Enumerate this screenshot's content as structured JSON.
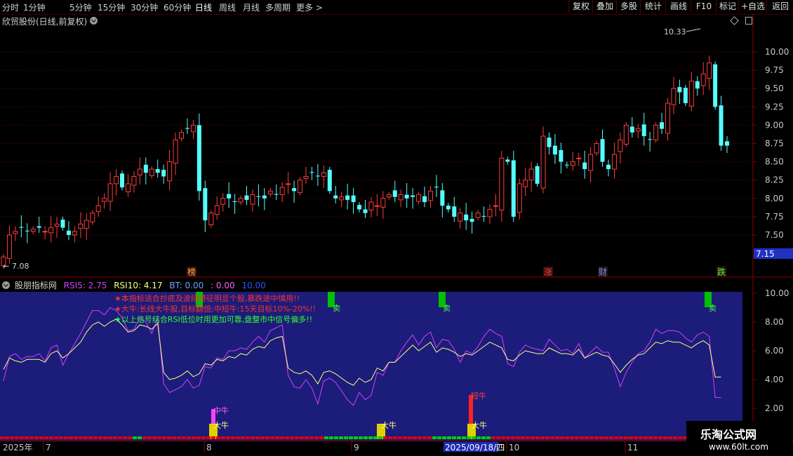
{
  "toolbar": {
    "periods": [
      "分时",
      "1分钟",
      "5分钟",
      "15分钟",
      "30分钟",
      "60分钟",
      "日线",
      "周线",
      "月线",
      "多周期",
      "更多 >"
    ],
    "active_period": "日线",
    "buttons": [
      "复权",
      "叠加",
      "多股",
      "统计",
      "画线",
      "F10",
      "标记",
      "+自选",
      "返回"
    ]
  },
  "main_chart": {
    "title": "欣贸股份(日线,前复权)",
    "high_label": "10.33",
    "low_label": "7.08",
    "last_price": "7.15",
    "y_axis": [
      "10.00",
      "9.75",
      "9.50",
      "9.25",
      "9.00",
      "8.75",
      "8.50",
      "8.25",
      "8.00",
      "7.75",
      "7.50"
    ],
    "markers": [
      "榜",
      "涨",
      "财",
      "跌"
    ],
    "colors": {
      "up": "#ff3c3c",
      "down": "#54ffff",
      "grid": "#6a0000",
      "axis_text": "#c8c8c8"
    }
  },
  "indicator": {
    "name": "股朋指标网",
    "rsi5_label": "RSI5: 2.75",
    "rsi10_label": "RSI10: 4.17",
    "bt_label": "BT: 0.00",
    "v1": ": 0.00",
    "v2": "10.00",
    "y_axis": [
      "10.00",
      "8.00",
      "6.00",
      "4.00",
      "2.00"
    ],
    "notes": [
      "★本指标适合抄底及波段特征明显个股,暴跌途中慎用!!",
      "★大牛:长线大牛股,目标翻倍;中短牛:15天目标10%-20%!!",
      "★以上信号结合RSI低位时用更加可靠,盘整市中信号偏多!!"
    ],
    "sell_label": "卖",
    "signals": [
      "中牛",
      "大牛",
      "大牛",
      "短牛",
      "大牛"
    ],
    "colors": {
      "bg": "#1c1c7a",
      "rsi5": "#d040ff",
      "rsi10": "#ffff80"
    }
  },
  "date_axis": {
    "year": "2025年",
    "months": [
      "7",
      "8",
      "9",
      "10",
      "11"
    ],
    "cursor_date": "2025/09/18/四"
  },
  "watermark": {
    "name": "乐淘公式网",
    "url": "www.60lt.com"
  },
  "chart_data": [
    {
      "type": "candlestick",
      "title": "欣贸股份(日线,前复权)",
      "ylim": [
        7.08,
        10.33
      ],
      "series": [
        {
          "name": "close",
          "values": [
            7.2,
            7.5,
            7.55,
            7.6,
            7.55,
            7.58,
            7.6,
            7.55,
            7.6,
            7.65,
            7.6,
            7.5,
            7.55,
            7.65,
            7.7,
            7.8,
            7.9,
            8.0,
            8.2,
            8.3,
            8.15,
            8.2,
            8.3,
            8.4,
            8.35,
            8.4,
            8.35,
            8.3,
            8.5,
            8.8,
            8.9,
            8.95,
            9.0,
            8.1,
            7.7,
            7.8,
            7.9,
            8.0,
            8.0,
            7.95,
            8.0,
            7.98,
            8.05,
            8.02,
            8.0,
            8.1,
            8.05,
            8.15,
            8.2,
            8.1,
            8.25,
            8.3,
            8.35,
            8.3,
            8.35,
            8.1,
            8.0,
            8.02,
            7.98,
            7.95,
            7.85,
            7.8,
            7.95,
            7.9,
            8.0,
            8.05,
            8.02,
            8.05,
            8.0,
            8.02,
            8.05,
            7.95,
            8.1,
            8.15,
            7.9,
            7.85,
            7.75,
            7.8,
            7.7,
            7.68,
            7.8,
            7.75,
            7.85,
            7.9,
            8.55,
            8.5,
            7.75,
            8.2,
            8.25,
            8.4,
            8.2,
            8.85,
            8.7,
            8.6,
            8.5,
            8.45,
            8.5,
            8.55,
            8.4,
            8.6,
            8.75,
            8.5,
            8.4,
            8.6,
            8.8,
            9.0,
            8.9,
            8.95,
            8.85,
            8.8,
            9.0,
            8.95,
            9.3,
            9.5,
            9.45,
            9.3,
            9.6,
            9.5,
            9.7,
            9.85,
            9.25,
            8.72,
            8.72
          ]
        }
      ]
    },
    {
      "type": "line",
      "title": "股朋指标网",
      "ylim": [
        1.0,
        10.0
      ],
      "series": [
        {
          "name": "RSI5",
          "values": [
            3.9,
            5.6,
            5.8,
            5.4,
            5.6,
            5.6,
            5.8,
            5.3,
            6.2,
            6.4,
            5.0,
            5.8,
            6.5,
            7.2,
            8.0,
            8.8,
            8.8,
            8.5,
            9.0,
            8.8,
            8.3,
            7.4,
            7.5,
            8.3,
            8.0,
            7.2,
            8.3,
            3.7,
            3.1,
            3.3,
            3.5,
            4.0,
            3.4,
            3.6,
            4.9,
            4.8,
            5.5,
            5.4,
            6.0,
            6.0,
            6.2,
            6.1,
            6.6,
            7.0,
            6.6,
            7.4,
            7.6,
            7.8,
            4.3,
            3.5,
            3.4,
            4.0,
            3.4,
            2.3,
            3.9,
            4.1,
            3.8,
            3.2,
            2.6,
            2.2,
            3.1,
            2.6,
            2.9,
            4.5,
            4.3,
            5.2,
            5.2,
            6.0,
            6.6,
            7.1,
            6.4,
            7.0,
            7.3,
            6.2,
            6.8,
            6.7,
            6.1,
            5.2,
            6.0,
            5.8,
            6.3,
            7.0,
            7.5,
            7.2,
            7.0,
            5.1,
            4.9,
            5.9,
            6.4,
            6.2,
            6.1,
            6.0,
            6.8,
            6.4,
            6.0,
            6.1,
            5.8,
            6.5,
            5.5,
            5.9,
            6.3,
            5.9,
            5.9,
            4.8,
            3.5,
            4.5,
            5.2,
            5.8,
            6.0,
            6.6,
            7.5,
            7.2,
            7.4,
            7.4,
            7.3,
            6.9,
            6.6,
            7.1,
            7.3,
            7.0,
            2.75,
            2.75
          ]
        },
        {
          "name": "RSI10",
          "values": [
            4.7,
            5.5,
            5.3,
            5.2,
            5.4,
            5.4,
            5.4,
            5.2,
            5.8,
            6.0,
            5.5,
            5.8,
            6.2,
            6.6,
            7.3,
            7.8,
            8.0,
            7.7,
            8.0,
            8.2,
            7.8,
            7.3,
            7.4,
            7.8,
            7.7,
            7.5,
            7.9,
            4.5,
            4.0,
            4.1,
            4.3,
            4.6,
            4.2,
            4.4,
            5.1,
            5.0,
            5.4,
            5.3,
            5.6,
            5.5,
            5.8,
            5.7,
            6.1,
            6.3,
            6.2,
            6.7,
            6.9,
            7.0,
            4.8,
            4.5,
            4.4,
            4.6,
            4.3,
            3.7,
            4.5,
            4.6,
            4.4,
            4.1,
            3.8,
            3.6,
            4.1,
            3.8,
            4.0,
            4.8,
            4.6,
            5.2,
            5.2,
            5.6,
            6.0,
            6.4,
            6.0,
            6.3,
            6.6,
            5.9,
            6.2,
            6.1,
            5.9,
            5.6,
            5.8,
            5.7,
            6.0,
            6.3,
            6.6,
            6.4,
            6.2,
            5.4,
            5.3,
            5.7,
            6.0,
            5.9,
            5.8,
            5.8,
            6.2,
            6.0,
            5.8,
            5.8,
            5.7,
            6.1,
            5.5,
            5.7,
            5.9,
            5.7,
            5.6,
            5.1,
            4.5,
            5.0,
            5.4,
            5.7,
            5.8,
            6.2,
            6.6,
            6.5,
            6.7,
            6.6,
            6.6,
            6.4,
            6.2,
            6.5,
            6.7,
            6.4,
            4.17,
            4.17
          ]
        }
      ]
    }
  ]
}
